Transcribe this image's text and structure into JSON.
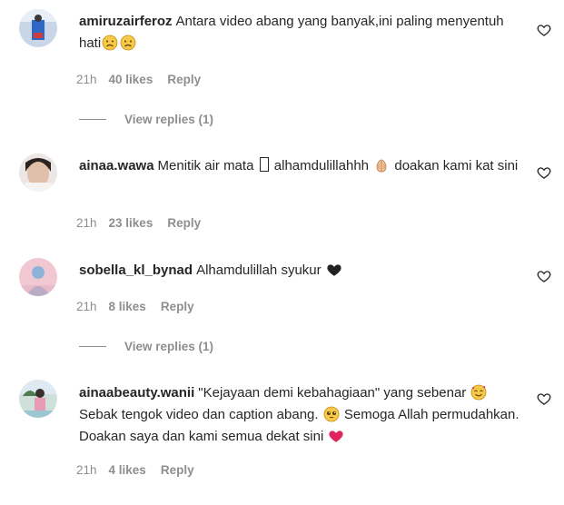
{
  "comments": [
    {
      "username": "amiruzairferoz",
      "text_before": "Antara video abang yang banyak,ini paling menyentuh hati",
      "emojis": [
        "sad-face-emoji",
        "sad-face-emoji"
      ],
      "time": "21h",
      "likes": "40 likes",
      "reply": "Reply",
      "view_replies": "View replies (1)"
    },
    {
      "username": "ainaa.wawa",
      "text_part1": "Menitik air mata",
      "text_part2": "alhamdulillahhh",
      "text_part3": "doakan kami kat sini",
      "time": "21h",
      "likes": "23 likes",
      "reply": "Reply"
    },
    {
      "username": "sobella_kl_bynad",
      "text": "Alhamdulillah syukur",
      "time": "21h",
      "likes": "8 likes",
      "reply": "Reply",
      "view_replies": "View replies (1)"
    },
    {
      "username": "ainaabeauty.wanii",
      "text_part1": "\"Kejayaan demi kebahagiaan\" yang sebenar",
      "text_part2": "Sebak tengok video dan caption abang.",
      "text_part3": "Semoga Allah permudahkan. Doakan saya dan kami semua dekat sini",
      "time": "21h",
      "likes": "4 likes",
      "reply": "Reply"
    }
  ],
  "colors": {
    "text": "#262626",
    "secondary": "#8e8e8e"
  }
}
